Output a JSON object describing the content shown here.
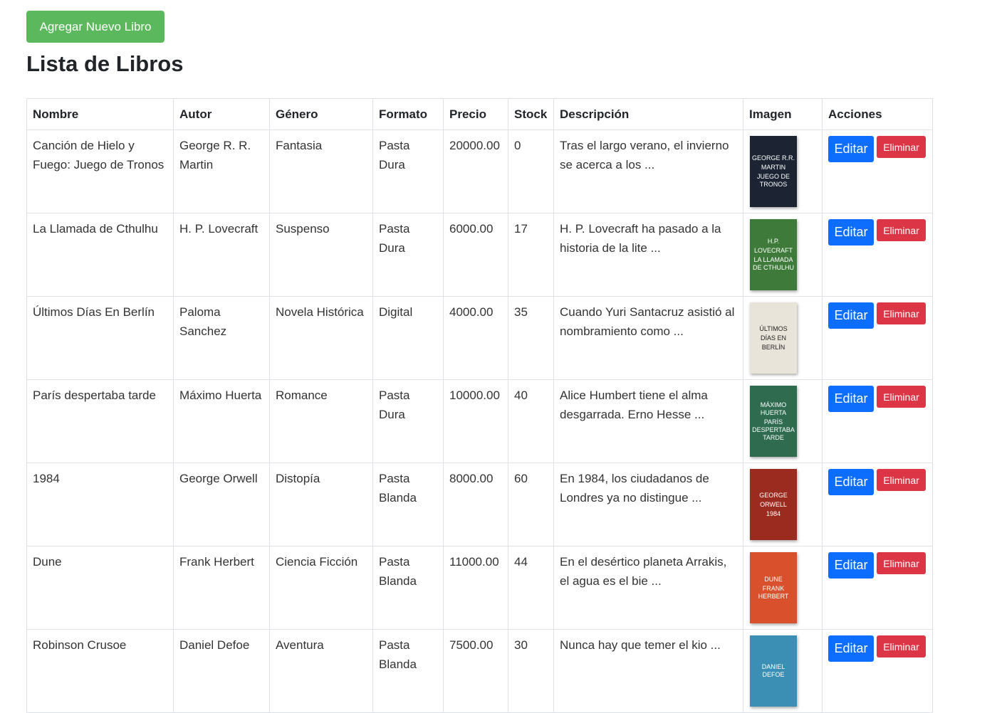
{
  "add_button_label": "Agregar Nuevo Libro",
  "page_title": "Lista de Libros",
  "columns": [
    "Nombre",
    "Autor",
    "Género",
    "Formato",
    "Precio",
    "Stock",
    "Descripción",
    "Imagen",
    "Acciones"
  ],
  "actions": {
    "edit_label": "Editar",
    "delete_label": "Eliminar"
  },
  "colors": {
    "add": "#5cb85c",
    "edit": "#0d6efd",
    "delete": "#dc3545"
  },
  "books": [
    {
      "nombre": "Canción de Hielo y Fuego: Juego de Tronos",
      "autor": "George R. R. Martin",
      "genero": "Fantasia",
      "formato": "Pasta Dura",
      "precio": "20000.00",
      "stock": "0",
      "descripcion": "Tras el largo verano, el invierno se acerca a los ...",
      "cover": {
        "lines": [
          "GEORGE R.R.",
          "MARTIN",
          "JUEGO DE TRONOS"
        ],
        "color": "#1c2434"
      }
    },
    {
      "nombre": "La Llamada de Cthulhu",
      "autor": "H. P. Lovecraft",
      "genero": "Suspenso",
      "formato": "Pasta Dura",
      "precio": "6000.00",
      "stock": "17",
      "descripcion": "H. P. Lovecraft ha pasado a la historia de la lite ...",
      "cover": {
        "lines": [
          "H.P.",
          "LOVECRAFT",
          "LA LLAMADA DE CTHULHU"
        ],
        "color": "#3e7a3a"
      }
    },
    {
      "nombre": "Últimos Días En Berlín",
      "autor": "Paloma Sanchez",
      "genero": "Novela Histórica",
      "formato": "Digital",
      "precio": "4000.00",
      "stock": "35",
      "descripcion": "Cuando Yuri Santacruz asistió al nombramiento como ...",
      "cover": {
        "lines": [
          "ÚLTIMOS",
          "DÍAS EN",
          "BERLÍN"
        ],
        "color": "#e9e4da"
      }
    },
    {
      "nombre": "París despertaba tarde",
      "autor": "Máximo Huerta",
      "genero": "Romance",
      "formato": "Pasta Dura",
      "precio": "10000.00",
      "stock": "40",
      "descripcion": "Alice Humbert tiene el alma desgarrada. Erno Hesse ...",
      "cover": {
        "lines": [
          "MÁXIMO HUERTA",
          "PARÍS DESPERTABA TARDE"
        ],
        "color": "#2f6b4f"
      }
    },
    {
      "nombre": "1984",
      "autor": "George Orwell",
      "genero": "Distopía",
      "formato": "Pasta Blanda",
      "precio": "8000.00",
      "stock": "60",
      "descripcion": "En 1984, los ciudadanos de Londres ya no distingue ...",
      "cover": {
        "lines": [
          "GEORGE",
          "ORWELL",
          "1984"
        ],
        "color": "#9b2b1f"
      }
    },
    {
      "nombre": "Dune",
      "autor": "Frank Herbert",
      "genero": "Ciencia Ficción",
      "formato": "Pasta Blanda",
      "precio": "11000.00",
      "stock": "44",
      "descripcion": "En el desértico planeta Arrakis, el agua es el bie ...",
      "cover": {
        "lines": [
          "DUNE",
          "FRANK HERBERT"
        ],
        "color": "#d9512c"
      }
    },
    {
      "nombre": "Robinson Crusoe",
      "autor": "Daniel Defoe",
      "genero": "Aventura",
      "formato": "Pasta Blanda",
      "precio": "7500.00",
      "stock": "30",
      "descripcion": "Nunca hay que temer el kio ...",
      "cover": {
        "lines": [
          "DANIEL DEFOE"
        ],
        "color": "#3b8fb4"
      }
    }
  ]
}
